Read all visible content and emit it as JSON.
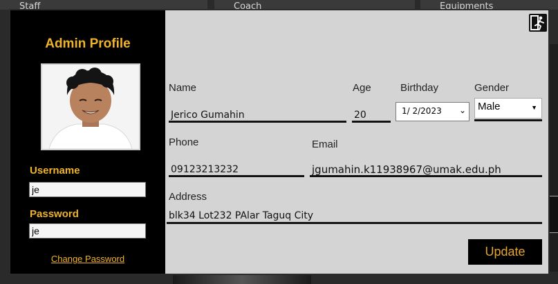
{
  "background": {
    "tabs": [
      "Staff",
      "Coach",
      "Equipments"
    ]
  },
  "dialog": {
    "title": "Admin Profile",
    "username_label": "Username",
    "username_value": "je",
    "password_label": "Password",
    "password_value": "je",
    "change_password_label": "Change Password",
    "fields": {
      "name_label": "Name",
      "name_value": "Jerico Gumahin",
      "age_label": "Age",
      "age_value": "20",
      "birthday_label": "Birthday",
      "birthday_value": "1/ 2/2023",
      "gender_label": "Gender",
      "gender_value": "Male",
      "phone_label": "Phone",
      "phone_value": "09123213232",
      "email_label": "Email",
      "email_value": "jgumahin.k11938967@umak.edu.ph",
      "address_label": "Address",
      "address_value": "blk34 Lot232 PAlar Taguq City"
    },
    "update_label": "Update",
    "icons": {
      "exit": "exit-running-man-icon",
      "date_dropdown": "chevron-down-icon",
      "gender_dropdown": "caret-down-icon"
    }
  },
  "colors": {
    "accent_gold": "#f0b428",
    "panel_black": "#000000",
    "dialog_gray": "#d4d4d4"
  }
}
